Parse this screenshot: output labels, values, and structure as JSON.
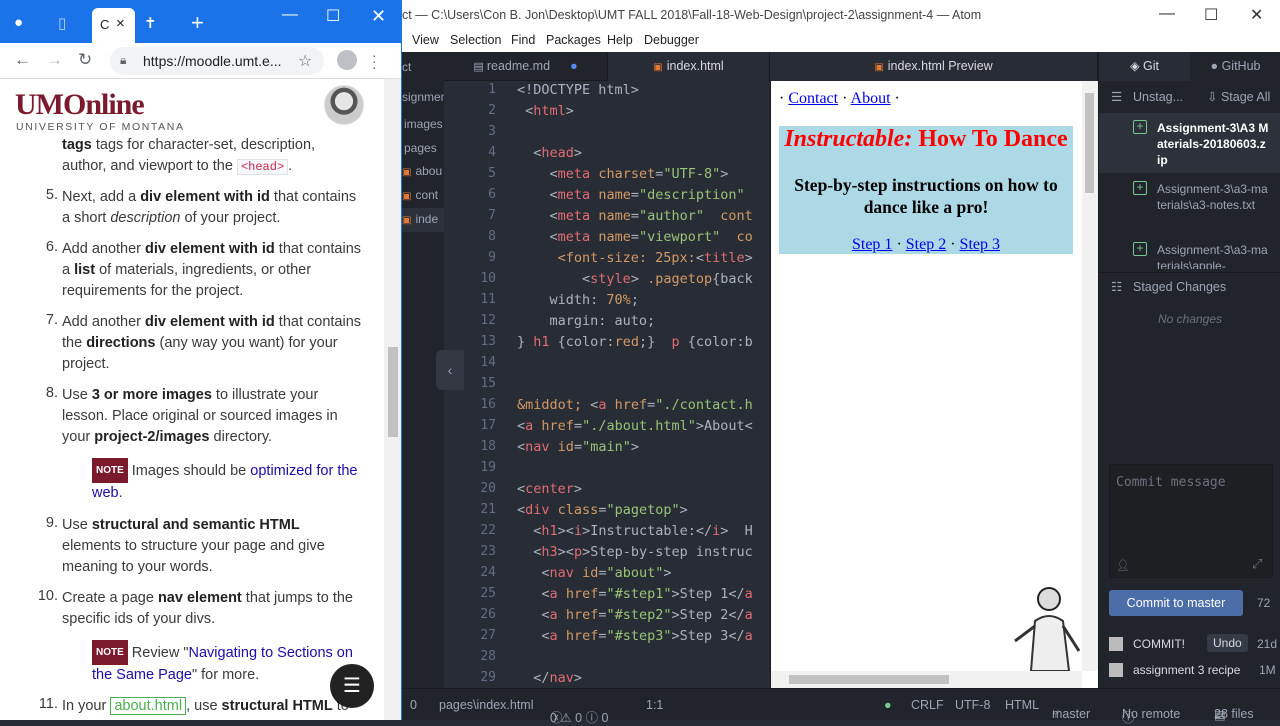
{
  "chrome": {
    "tab_label": "C",
    "url": "https://moodle.umt.e...",
    "page": {
      "logo_text": "UMOnline",
      "logo_sub": "UNIVERSITY OF MONTANA",
      "item4_tail": "tags for character-set, description, author, and viewport to the",
      "item4_code": "<head>",
      "item4_end": ".",
      "item5_num": "5.",
      "item5_pre": "Next, add a ",
      "item5_b": "div element with id",
      "item5_post": " that contains a short ",
      "item5_i": "description",
      "item5_end": " of your project.",
      "item6_num": "6.",
      "item6_pre": "Add another ",
      "item6_b": "div element with id",
      "item6_mid": " that contains a ",
      "item6_b2": "list",
      "item6_post": " of materials, ingredients, or other requirements for the project.",
      "item7_num": "7.",
      "item7_pre": "Add another ",
      "item7_b": "div element with id",
      "item7_mid": " that contains the ",
      "item7_b2": "directions",
      "item7_post": " (any way you want) for your project.",
      "item8_num": "8.",
      "item8_pre": "Use ",
      "item8_b": "3 or more images",
      "item8_mid": " to illustrate your lesson. Place original or sourced images in your ",
      "item8_b2": "project-2/images",
      "item8_post": " directory.",
      "note_label": "NOTE",
      "note1_pre": "Images should be ",
      "note1_link": "optimized for the web",
      "note1_post": ".",
      "item9_num": "9.",
      "item9_pre": "Use ",
      "item9_b": "structural and semantic HTML",
      "item9_post": " elements to structure your page and give meaning to your words.",
      "item10_num": "10.",
      "item10_pre": "Create a page ",
      "item10_b": "nav element",
      "item10_post": " that jumps to the specific ids of your divs.",
      "note2_pre": "Review \"",
      "note2_link": "Navigating to Sections on the Same Page",
      "note2_post": "\" for more.",
      "item11_num": "11.",
      "item11_pre": "In your ",
      "item11_code": "about.html",
      "item11_mid": ", use ",
      "item11_b": "structural HTML",
      "item11_post": " to"
    }
  },
  "atom": {
    "title": "ct — C:\\Users\\Con B. Jon\\Desktop\\UMT FALL 2018\\Fall-18-Web-Design\\project-2\\assignment-4 — Atom",
    "menu": [
      "View",
      "Selection",
      "Find",
      "Packages",
      "Help",
      "Debugger"
    ],
    "tree": [
      "ct",
      "signmen",
      "images",
      "pages",
      "abou",
      "cont",
      "inde"
    ],
    "tabs": {
      "readme": "readme.md",
      "index": "index.html",
      "preview": "index.html Preview"
    },
    "line_numbers": [
      "1",
      "2",
      "3",
      "4",
      "5",
      "6",
      "7",
      "8",
      "9",
      "10",
      "11",
      "12",
      "13",
      "14",
      "15",
      "16",
      "17",
      "18",
      "19",
      "20",
      "21",
      "22",
      "23",
      "24",
      "25",
      "26",
      "27",
      "28",
      "29"
    ],
    "preview": {
      "nav_sep": "·",
      "nav_contact": "Contact",
      "nav_about": "About",
      "h1_italic": "Instructable:",
      "h1_rest": " How To Dance",
      "h3": "Step-by-step instructions on how to dance like a pro!",
      "step1": "Step 1",
      "step2": "Step 2",
      "step3": "Step 3"
    },
    "git": {
      "tab_git": "Git",
      "tab_github": "GitHub",
      "unstaged": "Unstag...",
      "stage_all": "Stage All",
      "files": [
        "Assignment-3\\A3 Materials-20180603.zip",
        "Assignment-3\\a3-materials\\a3-notes.txt",
        "Assignment-3\\a3-materials\\apple-"
      ],
      "staged": "Staged Changes",
      "no_changes": "No changes",
      "commit_placeholder": "Commit message",
      "commit_btn": "Commit to master",
      "count": "72",
      "history": [
        {
          "msg": "COMMIT!",
          "extra": "Undo",
          "time": "21d"
        },
        {
          "msg": "assignment 3 recipe",
          "extra": "",
          "time": "1M"
        }
      ]
    },
    "status": {
      "tree_count": "0",
      "path": "pages\\index.html",
      "problems": "0 ⚠ 0 ⓘ 0",
      "cursor": "1:1",
      "eol": "CRLF",
      "enc": "UTF-8",
      "grammar": "HTML",
      "branch": "master",
      "remote": "No remote",
      "files": "28 files"
    }
  }
}
